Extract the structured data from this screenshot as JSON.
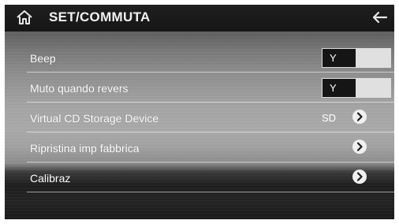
{
  "header": {
    "title": "SET/COMMUTA",
    "home_icon": "home-icon",
    "back_icon": "back-arrow-icon"
  },
  "rows": [
    {
      "label": "Beep",
      "control": "toggle",
      "toggle_value": "Y"
    },
    {
      "label": "Muto quando revers",
      "control": "toggle",
      "toggle_value": "Y"
    },
    {
      "label": "Virtual CD Storage Device",
      "control": "arrow",
      "value": "SD"
    },
    {
      "label": "Ripristina imp fabbrica",
      "control": "arrow"
    },
    {
      "label": "Calibraz",
      "control": "arrow"
    }
  ],
  "icons": {
    "arrow": "chevron-right-circle-icon"
  },
  "colors": {
    "header_bg": "#1a1a1a",
    "text": "#ffffff",
    "toggle_on_bg": "#151515",
    "toggle_off_bg": "#e0e0e0"
  }
}
